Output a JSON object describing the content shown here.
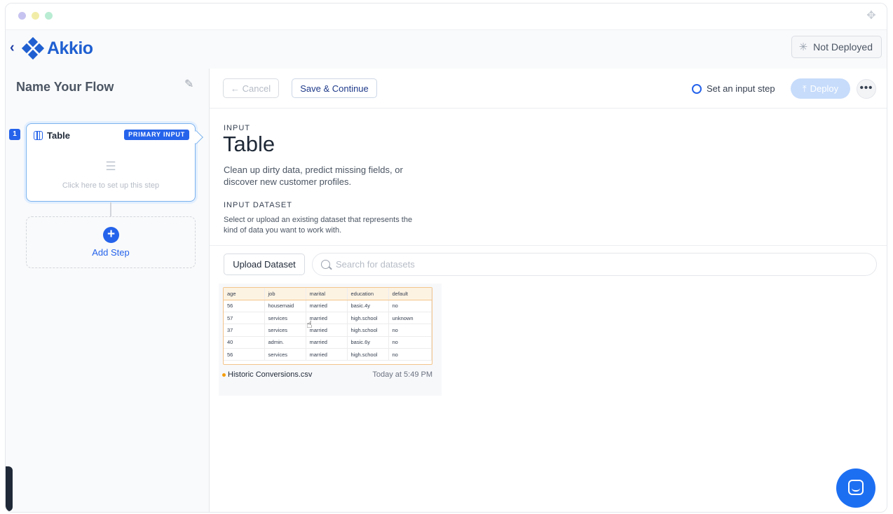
{
  "header": {
    "brand": "Akkio",
    "deploy_status": "Not Deployed"
  },
  "sidebar": {
    "flow_name": "Name Your Flow",
    "steps": [
      {
        "number": "1",
        "title": "Table",
        "badge": "PRIMARY INPUT",
        "hint": "Click here to set up this step"
      }
    ],
    "add_step_label": "Add Step"
  },
  "toolbar": {
    "cancel_label": "← Cancel",
    "save_label": "Save & Continue",
    "input_step_label": "Set an input step",
    "deploy_label": "Deploy",
    "more_label": "•••"
  },
  "main": {
    "section_label": "INPUT",
    "title": "Table",
    "description": "Clean up dirty data, predict missing fields, or discover new customer profiles.",
    "dataset_section_label": "INPUT DATASET",
    "dataset_description": "Select or upload an existing dataset that represents the kind of data you want to work with.",
    "upload_label": "Upload Dataset",
    "search_placeholder": "Search for datasets"
  },
  "dataset": {
    "name": "Historic Conversions.csv",
    "time": "Today at 5:49 PM",
    "columns": [
      "age",
      "job",
      "marital",
      "education",
      "default"
    ],
    "rows": [
      [
        "56",
        "housemaid",
        "married",
        "basic.4y",
        "no"
      ],
      [
        "57",
        "services",
        "married",
        "high.school",
        "unknown"
      ],
      [
        "37",
        "services",
        "married",
        "high.school",
        "no"
      ],
      [
        "40",
        "admin.",
        "married",
        "basic.6y",
        "no"
      ],
      [
        "56",
        "services",
        "married",
        "high.school",
        "no"
      ]
    ]
  },
  "colors": {
    "brand": "#1f5fd1",
    "accent": "#2563eb",
    "deploy_disabled": "#c7dcfb",
    "preview_border": "#f3c58c"
  }
}
